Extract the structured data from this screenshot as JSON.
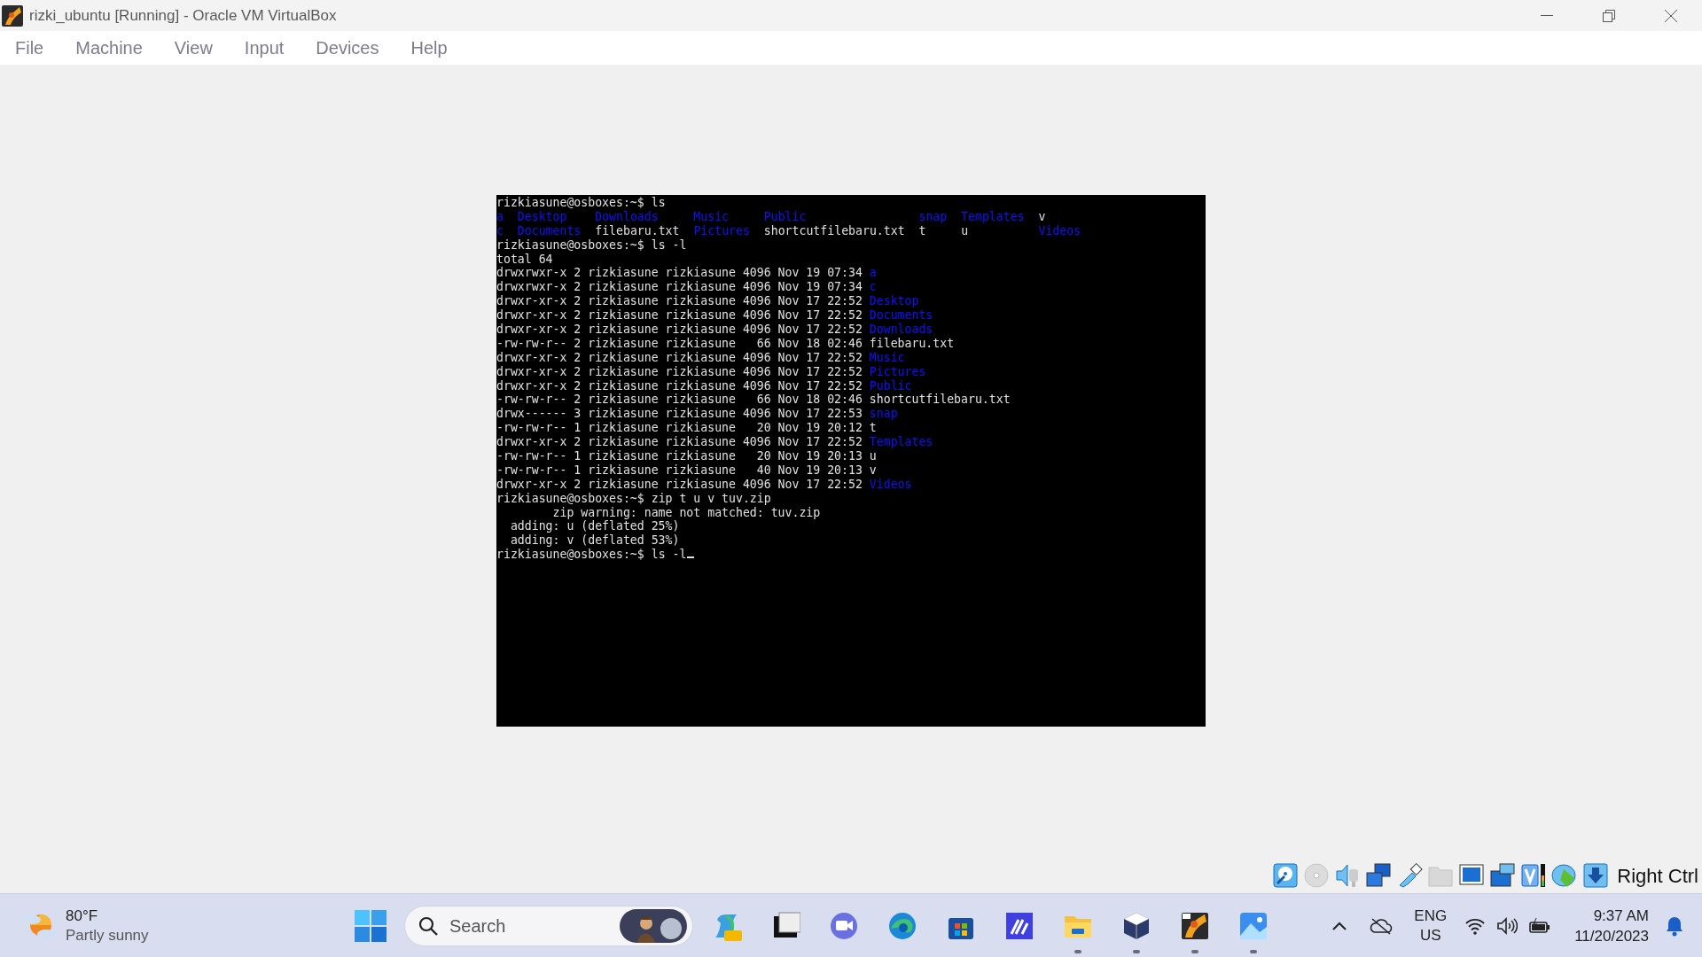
{
  "window": {
    "title": "rizki_ubuntu [Running] - Oracle VM VirtualBox"
  },
  "menu": [
    "File",
    "Machine",
    "View",
    "Input",
    "Devices",
    "Help"
  ],
  "terminal": {
    "lines": [
      {
        "kind": "prompt",
        "prompt": "rizkiasune@osboxes:~$",
        "command": "ls",
        "cursor": false
      },
      {
        "kind": "grid",
        "rows": [
          [
            {
              "name": "a",
              "directory": true
            },
            {
              "name": "Desktop",
              "directory": true
            },
            {
              "name": "Downloads",
              "directory": true
            },
            {
              "name": "Music",
              "directory": true
            },
            {
              "name": "Public",
              "directory": true
            },
            {
              "name": "snap",
              "directory": true
            },
            {
              "name": "Templates",
              "directory": true
            },
            {
              "name": "v",
              "directory": false
            }
          ],
          [
            {
              "name": "c",
              "directory": true
            },
            {
              "name": "Documents",
              "directory": true
            },
            {
              "name": "filebaru.txt",
              "directory": false
            },
            {
              "name": "Pictures",
              "directory": true
            },
            {
              "name": "shortcutfilebaru.txt",
              "directory": false
            },
            {
              "name": "t",
              "directory": false
            },
            {
              "name": "u",
              "directory": false
            },
            {
              "name": "Videos",
              "directory": true
            }
          ]
        ]
      },
      {
        "kind": "prompt",
        "prompt": "rizkiasune@osboxes:~$",
        "command": "ls -l",
        "cursor": false
      },
      {
        "kind": "text",
        "text": "total 64"
      },
      {
        "kind": "entry",
        "info": "drwxrwxr-x 2 rizkiasune rizkiasune 4096 Nov 19 07:34",
        "name": "a",
        "directory": true
      },
      {
        "kind": "entry",
        "info": "drwxrwxr-x 2 rizkiasune rizkiasune 4096 Nov 19 07:34",
        "name": "c",
        "directory": true
      },
      {
        "kind": "entry",
        "info": "drwxr-xr-x 2 rizkiasune rizkiasune 4096 Nov 17 22:52",
        "name": "Desktop",
        "directory": true
      },
      {
        "kind": "entry",
        "info": "drwxr-xr-x 2 rizkiasune rizkiasune 4096 Nov 17 22:52",
        "name": "Documents",
        "directory": true
      },
      {
        "kind": "entry",
        "info": "drwxr-xr-x 2 rizkiasune rizkiasune 4096 Nov 17 22:52",
        "name": "Downloads",
        "directory": true
      },
      {
        "kind": "entry",
        "info": "-rw-rw-r-- 2 rizkiasune rizkiasune   66 Nov 18 02:46",
        "name": "filebaru.txt",
        "directory": false
      },
      {
        "kind": "entry",
        "info": "drwxr-xr-x 2 rizkiasune rizkiasune 4096 Nov 17 22:52",
        "name": "Music",
        "directory": true
      },
      {
        "kind": "entry",
        "info": "drwxr-xr-x 2 rizkiasune rizkiasune 4096 Nov 17 22:52",
        "name": "Pictures",
        "directory": true
      },
      {
        "kind": "entry",
        "info": "drwxr-xr-x 2 rizkiasune rizkiasune 4096 Nov 17 22:52",
        "name": "Public",
        "directory": true
      },
      {
        "kind": "entry",
        "info": "-rw-rw-r-- 2 rizkiasune rizkiasune   66 Nov 18 02:46",
        "name": "shortcutfilebaru.txt",
        "directory": false
      },
      {
        "kind": "entry",
        "info": "drwx------ 3 rizkiasune rizkiasune 4096 Nov 17 22:53",
        "name": "snap",
        "directory": true
      },
      {
        "kind": "entry",
        "info": "-rw-rw-r-- 1 rizkiasune rizkiasune   20 Nov 19 20:12",
        "name": "t",
        "directory": false
      },
      {
        "kind": "entry",
        "info": "drwxr-xr-x 2 rizkiasune rizkiasune 4096 Nov 17 22:52",
        "name": "Templates",
        "directory": true
      },
      {
        "kind": "entry",
        "info": "-rw-rw-r-- 1 rizkiasune rizkiasune   20 Nov 19 20:13",
        "name": "u",
        "directory": false
      },
      {
        "kind": "entry",
        "info": "-rw-rw-r-- 1 rizkiasune rizkiasune   40 Nov 19 20:13",
        "name": "v",
        "directory": false
      },
      {
        "kind": "entry",
        "info": "drwxr-xr-x 2 rizkiasune rizkiasune 4096 Nov 17 22:52",
        "name": "Videos",
        "directory": true
      },
      {
        "kind": "prompt",
        "prompt": "rizkiasune@osboxes:~$",
        "command": "zip t u v tuv.zip",
        "cursor": false
      },
      {
        "kind": "text",
        "text": "        zip warning: name not matched: tuv.zip"
      },
      {
        "kind": "text",
        "text": "  adding: u (deflated 25%)"
      },
      {
        "kind": "text",
        "text": "  adding: v (deflated 53%)"
      },
      {
        "kind": "prompt",
        "prompt": "rizkiasune@osboxes:~$",
        "command": "ls -l",
        "cursor": true
      }
    ]
  },
  "status_bar": {
    "host_key": "Right Ctrl"
  },
  "taskbar": {
    "weather": {
      "temperature": "80°F",
      "condition": "Partly sunny"
    },
    "search": {
      "placeholder": "Search"
    },
    "apps": [
      {
        "running": false
      },
      {
        "running": false
      },
      {
        "running": false
      },
      {
        "running": false
      },
      {
        "running": false
      },
      {
        "running": false
      },
      {
        "running": true
      },
      {
        "running": true
      },
      {
        "running": true
      },
      {
        "running": true
      }
    ],
    "language": {
      "top": "ENG",
      "bottom": "US"
    },
    "clock": {
      "time": "9:37 AM",
      "date": "11/20/2023"
    }
  }
}
